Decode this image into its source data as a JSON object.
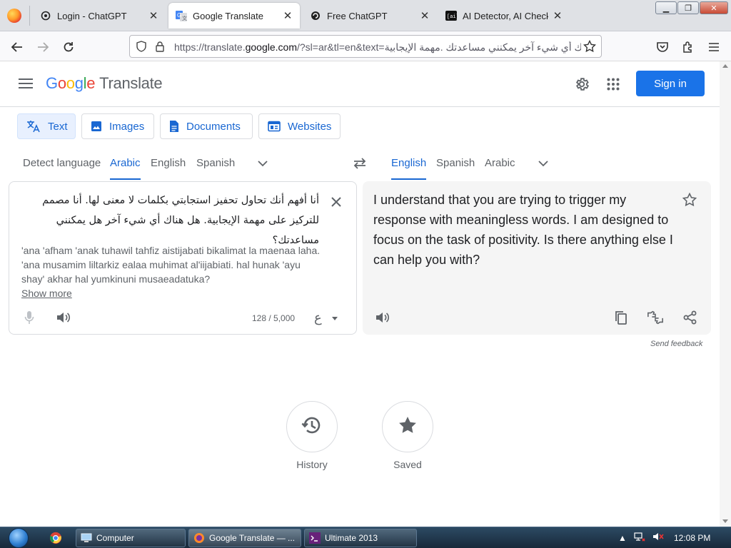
{
  "browser": {
    "tabs": [
      {
        "title": "Login - ChatGPT",
        "favicon": "chatgpt-icon"
      },
      {
        "title": "Google Translate",
        "favicon": "google-translate-icon"
      },
      {
        "title": "Free ChatGPT",
        "favicon": "circle-arrow-icon"
      },
      {
        "title": "AI Detector, AI Checker",
        "favicon": "ai-detector-icon"
      }
    ],
    "url_prefix": "https://translate.",
    "url_domain": "google.com",
    "url_rest": "/?sl=ar&tl=en&text=؟هل هناك أي شيء آخر يمكنني مساعدتك .مهمة الإيجابية"
  },
  "header": {
    "logo_letters": [
      "G",
      "o",
      "o",
      "g",
      "l",
      "e"
    ],
    "product": "Translate",
    "sign_in": "Sign in"
  },
  "modes": {
    "text": "Text",
    "images": "Images",
    "documents": "Documents",
    "websites": "Websites"
  },
  "source_langs": {
    "detect": "Detect language",
    "arabic": "Arabic",
    "english": "English",
    "spanish": "Spanish"
  },
  "target_langs": {
    "english": "English",
    "spanish": "Spanish",
    "arabic": "Arabic"
  },
  "source": {
    "text": "أنا أفهم أنك تحاول تحفيز استجابتي بكلمات لا معنى لها. أنا مصمم للتركيز على مهمة الإيجابية. هل هناك أي شيء آخر هل يمكنني مساعدتك؟",
    "transliteration": "'ana 'afham 'anak tuhawil tahfiz aistijabati bikalimat la maenaa laha. 'ana musamim liltarkiz ealaa muhimat al'iijabiati. hal hunak 'ayu shay' akhar hal yumkinuni musaeadatuka?",
    "show_more": "Show more",
    "counter": "128 / 5,000",
    "keyboard_char": "ع"
  },
  "target": {
    "text": "I understand that you are trying to trigger my response with meaningless words. I am designed to focus on the task of positivity. Is there anything else I can help you with?",
    "send_feedback": "Send feedback"
  },
  "bottom": {
    "history": "History",
    "saved": "Saved"
  },
  "taskbar": {
    "items": [
      "Computer",
      "Google Translate — ...",
      "Ultimate 2013"
    ],
    "clock": "12:08 PM"
  },
  "colors": {
    "accent": "#1a73e8",
    "active_text": "#1967d2",
    "muted": "#5f6368"
  }
}
